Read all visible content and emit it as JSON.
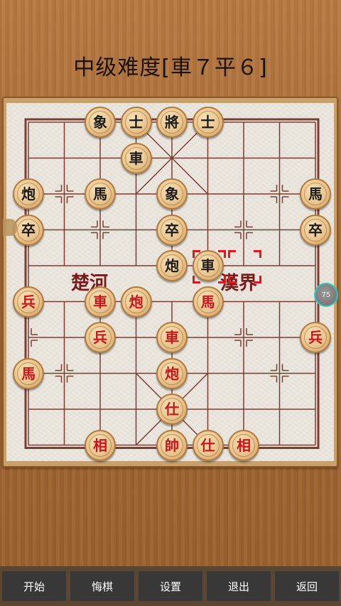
{
  "title": "中级难度[車７平６]",
  "river": {
    "left": "楚河",
    "right": "漢界"
  },
  "float_button": {
    "label": "75"
  },
  "pieces": [
    {
      "char": "象",
      "side": "black",
      "col": 2,
      "row": 0
    },
    {
      "char": "士",
      "side": "black",
      "col": 3,
      "row": 0
    },
    {
      "char": "將",
      "side": "black",
      "col": 4,
      "row": 0
    },
    {
      "char": "士",
      "side": "black",
      "col": 5,
      "row": 0
    },
    {
      "char": "車",
      "side": "black",
      "col": 3,
      "row": 1
    },
    {
      "char": "炮",
      "side": "black",
      "col": 0,
      "row": 2
    },
    {
      "char": "馬",
      "side": "black",
      "col": 2,
      "row": 2
    },
    {
      "char": "象",
      "side": "black",
      "col": 4,
      "row": 2
    },
    {
      "char": "馬",
      "side": "black",
      "col": 8,
      "row": 2
    },
    {
      "char": "卒",
      "side": "black",
      "col": 0,
      "row": 3
    },
    {
      "char": "卒",
      "side": "black",
      "col": 4,
      "row": 3
    },
    {
      "char": "卒",
      "side": "black",
      "col": 8,
      "row": 3
    },
    {
      "char": "炮",
      "side": "black",
      "col": 4,
      "row": 4
    },
    {
      "char": "車",
      "side": "black",
      "col": 5,
      "row": 4
    },
    {
      "char": "兵",
      "side": "red",
      "col": 0,
      "row": 5
    },
    {
      "char": "車",
      "side": "red",
      "col": 2,
      "row": 5
    },
    {
      "char": "炮",
      "side": "red",
      "col": 3,
      "row": 5
    },
    {
      "char": "馬",
      "side": "red",
      "col": 5,
      "row": 5
    },
    {
      "char": "兵",
      "side": "red",
      "col": 2,
      "row": 6
    },
    {
      "char": "車",
      "side": "red",
      "col": 4,
      "row": 6
    },
    {
      "char": "兵",
      "side": "red",
      "col": 8,
      "row": 6
    },
    {
      "char": "馬",
      "side": "red",
      "col": 0,
      "row": 7
    },
    {
      "char": "炮",
      "side": "red",
      "col": 4,
      "row": 7
    },
    {
      "char": "仕",
      "side": "red",
      "col": 4,
      "row": 8
    },
    {
      "char": "相",
      "side": "red",
      "col": 2,
      "row": 9
    },
    {
      "char": "帥",
      "side": "red",
      "col": 4,
      "row": 9
    },
    {
      "char": "仕",
      "side": "red",
      "col": 5,
      "row": 9
    },
    {
      "char": "相",
      "side": "red",
      "col": 6,
      "row": 9
    }
  ],
  "last_move_markers": [
    {
      "col": 5,
      "row": 4
    },
    {
      "col": 6,
      "row": 4
    }
  ],
  "toolbar": {
    "start": "开始",
    "undo": "悔棋",
    "settings": "设置",
    "exit": "退出",
    "back": "返回"
  },
  "colors": {
    "red_piece_text": "#c8161d",
    "black_piece_text": "#1b1b1b",
    "grid_line": "#7a3e33",
    "toolbar_bg": "#5b4632",
    "button_bg": "#383838",
    "float_button_ring": "#32c7c0"
  }
}
